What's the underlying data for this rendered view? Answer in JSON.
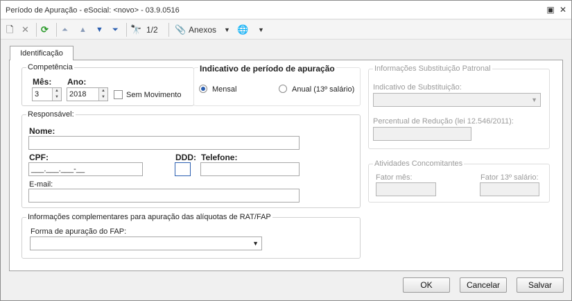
{
  "window": {
    "title": "Período de Apuração - eSocial: <novo> - 03.9.0516"
  },
  "toolbar": {
    "page": "1/2",
    "anexos": "Anexos"
  },
  "tabs": [
    {
      "label": "Identificação"
    }
  ],
  "competencia": {
    "legend": "Competência",
    "mes_label": "Mês:",
    "mes_value": "3",
    "ano_label": "Ano:",
    "ano_value": "2018",
    "sem_movimento": "Sem Movimento"
  },
  "indicativo": {
    "legend": "Indicativo de período de apuração",
    "mensal": "Mensal",
    "anual": "Anual (13º salário)",
    "selected": "Mensal"
  },
  "responsavel": {
    "legend": "Responsável:",
    "nome_label": "Nome:",
    "nome_value": "",
    "cpf_label": "CPF:",
    "cpf_value": "___.___.___-__",
    "ddd_label": "DDD:",
    "ddd_value": "",
    "telefone_label": "Telefone:",
    "telefone_value": "",
    "email_label": "E-mail:",
    "email_value": ""
  },
  "rat_fap": {
    "legend": "Informações complementares para apuração das alíquotas de RAT/FAP",
    "forma_label": "Forma de apuração do FAP:",
    "forma_value": ""
  },
  "substituicao": {
    "legend": "Informações Substituição Patronal",
    "indicativo_label": "Indicativo de Substituição:",
    "percentual_label": "Percentual de Redução  (lei 12.546/2011):"
  },
  "atividades": {
    "legend": "Atividades Concomitantes",
    "fator_mes_label": "Fator mês:",
    "fator_13_label": "Fator 13º salário:"
  },
  "buttons": {
    "ok": "OK",
    "cancelar": "Cancelar",
    "salvar": "Salvar"
  }
}
